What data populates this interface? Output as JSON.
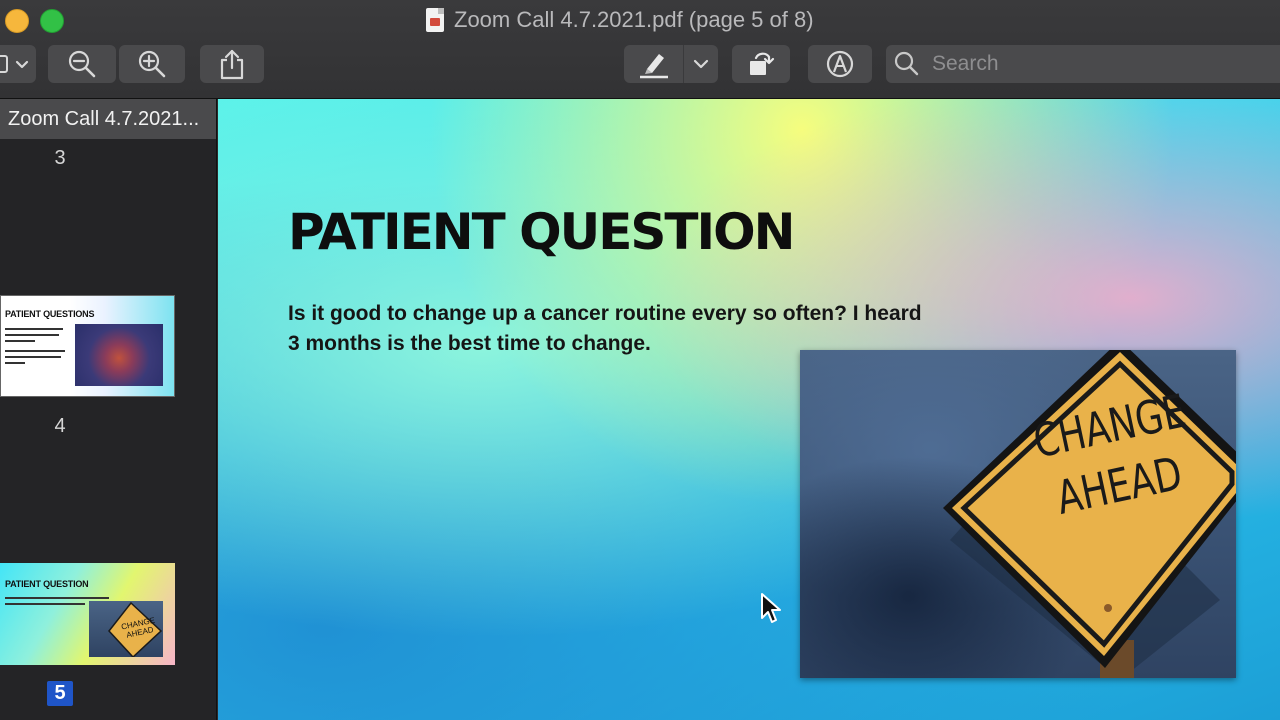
{
  "window": {
    "title": "Zoom Call 4.7.2021.pdf (page 5 of 8)"
  },
  "toolbar": {
    "sidebar_toggle_icon": "sidebar-icon",
    "zoom_out_icon": "zoom-out-icon",
    "zoom_in_icon": "zoom-in-icon",
    "share_icon": "share-icon",
    "highlight_icon": "highlighter-icon",
    "highlight_menu_icon": "chevron-down-icon",
    "rotate_icon": "rotate-icon",
    "markup_icon": "markup-icon",
    "search_placeholder": "Search"
  },
  "sidebar": {
    "document_name": "Zoom Call 4.7.2021...",
    "pages": [
      {
        "label": "3"
      },
      {
        "label": "4",
        "thumb_title": "PATIENT QUESTIONS"
      },
      {
        "label": "5",
        "thumb_title": "PATIENT QUESTION",
        "thumb_sign": "CHANGE AHEAD",
        "selected": true
      }
    ]
  },
  "slide": {
    "title": "PATIENT QUESTION",
    "body": "Is it good to change up a cancer routine every so often? I heard 3 months is the best time to change.",
    "sign_line1": "CHANGE",
    "sign_line2": "AHEAD"
  },
  "colors": {
    "accent_selected": "#1f55c8",
    "sign_yellow": "#e9b24a",
    "traffic_yellow": "#f6b73c",
    "traffic_green": "#32c146"
  }
}
